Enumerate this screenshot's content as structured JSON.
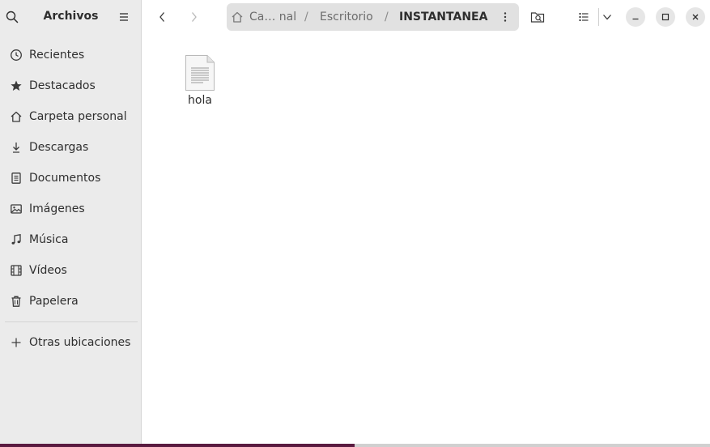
{
  "sidebar": {
    "title": "Archivos",
    "search_icon": "search-icon",
    "menu_icon": "hamburger-menu-icon",
    "items": [
      {
        "label": "Recientes",
        "icon": "clock-icon"
      },
      {
        "label": "Destacados",
        "icon": "star-icon"
      },
      {
        "label": "Carpeta personal",
        "icon": "home-icon"
      },
      {
        "label": "Descargas",
        "icon": "download-icon"
      },
      {
        "label": "Documentos",
        "icon": "document-icon"
      },
      {
        "label": "Imágenes",
        "icon": "image-icon"
      },
      {
        "label": "Música",
        "icon": "music-icon"
      },
      {
        "label": "Vídeos",
        "icon": "film-icon"
      },
      {
        "label": "Papelera",
        "icon": "trash-icon"
      }
    ],
    "other_locations": {
      "label": "Otras ubicaciones",
      "icon": "plus-icon"
    }
  },
  "header": {
    "breadcrumbs": [
      {
        "label": "Ca… nal"
      },
      {
        "label": "Escritorio"
      },
      {
        "label": "INSTANTANEA"
      }
    ],
    "separator": "/"
  },
  "files": [
    {
      "name": "hola",
      "icon": "text-file-icon"
    }
  ],
  "colors": {
    "sidebar_bg": "#ebebeb",
    "path_bar_bg": "#e1e1e1",
    "accent": "#5a1b40"
  }
}
